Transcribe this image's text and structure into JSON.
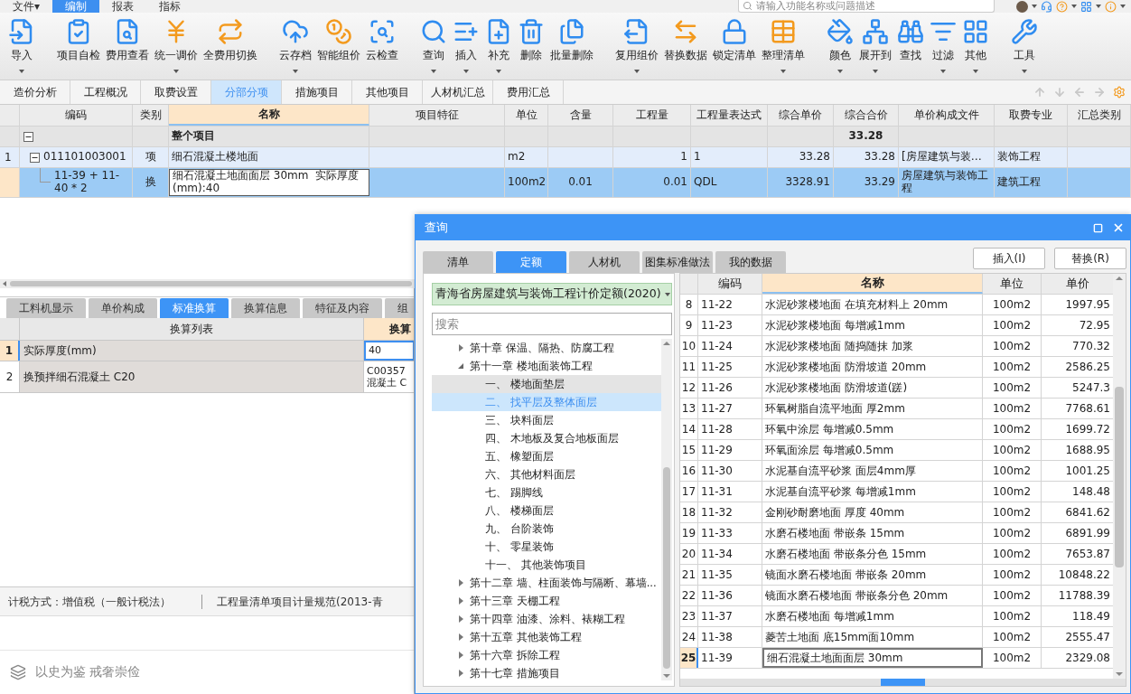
{
  "menu": [
    {
      "label": "文件▾",
      "selected": false
    },
    {
      "label": "编制",
      "selected": true
    },
    {
      "label": "报表",
      "selected": false
    },
    {
      "label": "指标",
      "selected": false
    }
  ],
  "search": {
    "placeholder": "请输入功能名称或问题描述"
  },
  "toolbar": [
    [
      {
        "label": "导入",
        "dropdown": true
      }
    ],
    [
      {
        "label": "项目自检",
        "dropdown": false
      },
      {
        "label": "费用查看",
        "dropdown": false
      },
      {
        "label": "统一调价",
        "dropdown": true
      },
      {
        "label": "全费用切换",
        "dropdown": false
      }
    ],
    [
      {
        "label": "云存档",
        "dropdown": true
      },
      {
        "label": "智能组价",
        "dropdown": false
      },
      {
        "label": "云检查",
        "dropdown": false
      }
    ],
    [
      {
        "label": "查询",
        "dropdown": true
      },
      {
        "label": "插入",
        "dropdown": true
      },
      {
        "label": "补充",
        "dropdown": true
      },
      {
        "label": "删除",
        "dropdown": false
      },
      {
        "label": "批量删除",
        "dropdown": false
      }
    ],
    [
      {
        "label": "复用组价",
        "dropdown": true
      },
      {
        "label": "替换数据",
        "dropdown": false
      },
      {
        "label": "锁定清单",
        "dropdown": false
      },
      {
        "label": "整理清单",
        "dropdown": true
      }
    ],
    [
      {
        "label": "颜色",
        "dropdown": true
      },
      {
        "label": "展开到",
        "dropdown": true
      },
      {
        "label": "查找",
        "dropdown": false
      },
      {
        "label": "过滤",
        "dropdown": true
      },
      {
        "label": "其他",
        "dropdown": true
      }
    ],
    [
      {
        "label": "工具",
        "dropdown": true
      }
    ]
  ],
  "view_tabs": [
    {
      "label": "造价分析",
      "selected": false
    },
    {
      "label": "工程概况",
      "selected": false
    },
    {
      "label": "取费设置",
      "selected": false
    },
    {
      "label": "分部分项",
      "selected": true
    },
    {
      "label": "措施项目",
      "selected": false
    },
    {
      "label": "其他项目",
      "selected": false
    },
    {
      "label": "人材机汇总",
      "selected": false
    },
    {
      "label": "费用汇总",
      "selected": false
    }
  ],
  "main_table": {
    "columns": [
      {
        "label": "编码",
        "selected": false
      },
      {
        "label": "类别",
        "selected": false
      },
      {
        "label": "名称",
        "selected": true
      },
      {
        "label": "项目特征",
        "selected": false
      },
      {
        "label": "单位",
        "selected": false
      },
      {
        "label": "含量",
        "selected": false
      },
      {
        "label": "工程量",
        "selected": false
      },
      {
        "label": "工程量表达式",
        "selected": false
      },
      {
        "label": "综合单价",
        "selected": false
      },
      {
        "label": "综合合价",
        "selected": false
      },
      {
        "label": "单价构成文件",
        "selected": false
      },
      {
        "label": "取费专业",
        "selected": false
      },
      {
        "label": "汇总类别",
        "selected": false
      }
    ],
    "rows": [
      {
        "kind": "group",
        "selected": false,
        "expanded": true,
        "name": "整个项目",
        "total_price": "33.28"
      },
      {
        "kind": "item",
        "selected": false,
        "expanded": true,
        "number": "1",
        "code": "011101003001",
        "type": "项",
        "name": "细石混凝土楼地面",
        "unit": "m2",
        "quantity": "1",
        "expression": "1",
        "unit_price": "33.28",
        "total_price": "33.28",
        "price_file": "[房屋建筑与装…",
        "fee_specialty": "装饰工程"
      },
      {
        "kind": "sub",
        "selected": true,
        "code": "11-39 + 11-40 * 2",
        "type": "换",
        "name": "细石混凝土地面面层 30mm  实际厚度(mm):40",
        "unit": "100m2",
        "content": "0.01",
        "quantity": "0.01",
        "expression": "QDL",
        "unit_price": "3328.91",
        "total_price": "33.29",
        "price_file": "房屋建筑与装饰工程",
        "fee_specialty": "建筑工程"
      }
    ]
  },
  "detail_tabs": [
    {
      "label": "工料机显示",
      "selected": false
    },
    {
      "label": "单价构成",
      "selected": false
    },
    {
      "label": "标准换算",
      "selected": true
    },
    {
      "label": "换算信息",
      "selected": false
    },
    {
      "label": "特征及内容",
      "selected": false
    },
    {
      "label": "组",
      "selected": false
    }
  ],
  "conversion_table": {
    "columns": [
      "换算列表",
      "换算"
    ],
    "rows": [
      {
        "number": "1",
        "name": "实际厚度(mm)",
        "value": "40",
        "selected": true
      },
      {
        "number": "2",
        "name": "换预拌细石混凝土 C20",
        "value": "C00357 混凝土 C",
        "selected": false
      }
    ]
  },
  "status_bar": [
    "计税方式：增值税（一般计税法）",
    "工程量清单项目计量规范(2013-青"
  ],
  "motto": "以史为鉴 戒奢崇俭",
  "dialog": {
    "title": "查询",
    "tabs": [
      {
        "label": "清单",
        "selected": false
      },
      {
        "label": "定额",
        "selected": true
      },
      {
        "label": "人材机",
        "selected": false
      },
      {
        "label": "图集标准做法",
        "selected": false
      },
      {
        "label": "我的数据",
        "selected": false
      }
    ],
    "buttons": [
      "插入(I)",
      "替换(R)"
    ],
    "library": "青海省房屋建筑与装饰工程计价定额(2020)",
    "search_placeholder": "搜索",
    "tree": [
      {
        "label": "第十章 保温、隔热、防腐工程",
        "expanded": false,
        "selected": false,
        "hovered": false
      },
      {
        "label": "第十一章 楼地面装饰工程",
        "expanded": true,
        "selected": false,
        "hovered": false,
        "children": [
          {
            "label": "一、 楼地面垫层",
            "selected": false,
            "hovered": true
          },
          {
            "label": "二、 找平层及整体面层",
            "selected": true,
            "hovered": false
          },
          {
            "label": "三、 块料面层",
            "selected": false,
            "hovered": false
          },
          {
            "label": "四、 木地板及复合地板面层",
            "selected": false,
            "hovered": false
          },
          {
            "label": "五、 橡塑面层",
            "selected": false,
            "hovered": false
          },
          {
            "label": "六、 其他材料面层",
            "selected": false,
            "hovered": false
          },
          {
            "label": "七、 踢脚线",
            "selected": false,
            "hovered": false
          },
          {
            "label": "八、 楼梯面层",
            "selected": false,
            "hovered": false
          },
          {
            "label": "九、 台阶装饰",
            "selected": false,
            "hovered": false
          },
          {
            "label": "十、 零星装饰",
            "selected": false,
            "hovered": false
          },
          {
            "label": "十一、 其他装饰项目",
            "selected": false,
            "hovered": false
          }
        ]
      },
      {
        "label": "第十二章 墙、柱面装饰与隔断、幕墙...",
        "expanded": false,
        "selected": false,
        "hovered": false
      },
      {
        "label": "第十三章 天棚工程",
        "expanded": false,
        "selected": false,
        "hovered": false
      },
      {
        "label": "第十四章 油漆、涂料、裱糊工程",
        "expanded": false,
        "selected": false,
        "hovered": false
      },
      {
        "label": "第十五章 其他装饰工程",
        "expanded": false,
        "selected": false,
        "hovered": false
      },
      {
        "label": "第十六章 拆除工程",
        "expanded": false,
        "selected": false,
        "hovered": false
      },
      {
        "label": "第十七章 措施项目",
        "expanded": false,
        "selected": false,
        "hovered": false
      }
    ],
    "table": {
      "columns": [
        {
          "label": "编码",
          "selected": false
        },
        {
          "label": "名称",
          "selected": true
        },
        {
          "label": "单位",
          "selected": false
        },
        {
          "label": "单价",
          "selected": false
        }
      ],
      "rows": [
        {
          "number": "8",
          "code": "11-22",
          "name": "水泥砂浆楼地面 在填充材料上 20mm",
          "unit": "100m2",
          "price": "1997.95",
          "selected": false
        },
        {
          "number": "9",
          "code": "11-23",
          "name": "水泥砂浆楼地面 每增减1mm",
          "unit": "100m2",
          "price": "72.95",
          "selected": false
        },
        {
          "number": "10",
          "code": "11-24",
          "name": "水泥砂浆楼地面 随捣随抹 加浆",
          "unit": "100m2",
          "price": "770.32",
          "selected": false
        },
        {
          "number": "11",
          "code": "11-25",
          "name": "水泥砂浆楼地面 防滑坡道 20mm",
          "unit": "100m2",
          "price": "2586.25",
          "selected": false
        },
        {
          "number": "12",
          "code": "11-26",
          "name": "水泥砂浆楼地面 防滑坡道(蹉)",
          "unit": "100m2",
          "price": "5247.3",
          "selected": false
        },
        {
          "number": "13",
          "code": "11-27",
          "name": "环氧树脂自流平地面 厚2mm",
          "unit": "100m2",
          "price": "7768.61",
          "selected": false
        },
        {
          "number": "14",
          "code": "11-28",
          "name": "环氧中涂层 每增减0.5mm",
          "unit": "100m2",
          "price": "1699.72",
          "selected": false
        },
        {
          "number": "15",
          "code": "11-29",
          "name": "环氧面涂层 每增减0.5mm",
          "unit": "100m2",
          "price": "1688.95",
          "selected": false
        },
        {
          "number": "16",
          "code": "11-30",
          "name": "水泥基自流平砂浆 面层4mm厚",
          "unit": "100m2",
          "price": "1001.25",
          "selected": false
        },
        {
          "number": "17",
          "code": "11-31",
          "name": "水泥基自流平砂浆 每增减1mm",
          "unit": "100m2",
          "price": "148.48",
          "selected": false
        },
        {
          "number": "18",
          "code": "11-32",
          "name": "金刚砂耐磨地面 厚度 40mm",
          "unit": "100m2",
          "price": "6841.62",
          "selected": false
        },
        {
          "number": "19",
          "code": "11-33",
          "name": "水磨石楼地面 带嵌条 15mm",
          "unit": "100m2",
          "price": "6891.99",
          "selected": false
        },
        {
          "number": "20",
          "code": "11-34",
          "name": "水磨石楼地面 带嵌条分色 15mm",
          "unit": "100m2",
          "price": "7653.87",
          "selected": false
        },
        {
          "number": "21",
          "code": "11-35",
          "name": "镜面水磨石楼地面 带嵌条 20mm",
          "unit": "100m2",
          "price": "10848.22",
          "selected": false
        },
        {
          "number": "22",
          "code": "11-36",
          "name": "镜面水磨石楼地面 带嵌条分色 20mm",
          "unit": "100m2",
          "price": "11788.39",
          "selected": false
        },
        {
          "number": "23",
          "code": "11-37",
          "name": "水磨石楼地面 每增减1mm",
          "unit": "100m2",
          "price": "118.49",
          "selected": false
        },
        {
          "number": "24",
          "code": "11-38",
          "name": "菱苦土地面 底15mm面10mm",
          "unit": "100m2",
          "price": "2555.47",
          "selected": false
        },
        {
          "number": "25",
          "code": "11-39",
          "name": "细石混凝土地面面层 30mm",
          "unit": "100m2",
          "price": "2329.08",
          "selected": true
        }
      ]
    }
  }
}
